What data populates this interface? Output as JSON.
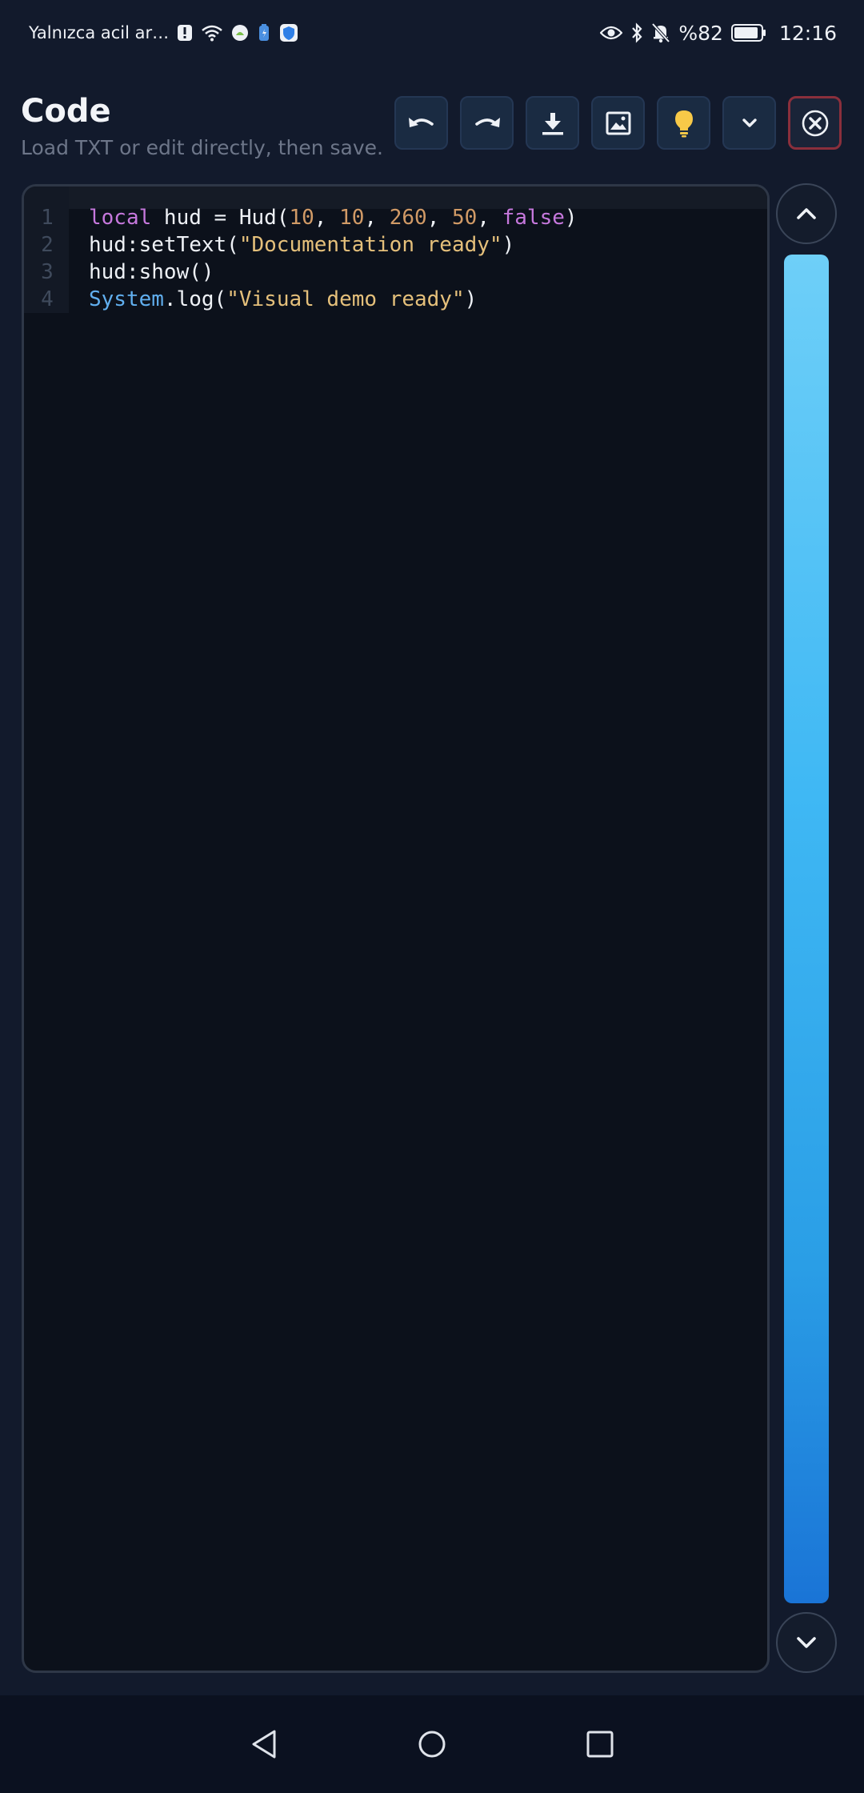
{
  "status_bar": {
    "carrier_text": "Yalnızca acil ar…",
    "battery_percent": "%82",
    "time": "12:16",
    "left_icons": [
      "alert-icon",
      "wifi-icon",
      "android-app-icon",
      "battery-saver-icon",
      "shield-app-icon"
    ],
    "right_icons": [
      "eye-icon",
      "bluetooth-icon",
      "bell-muted-icon",
      "battery-icon"
    ]
  },
  "header": {
    "title": "Code",
    "subtitle": "Load TXT or edit directly, then save."
  },
  "toolbar": {
    "buttons": [
      {
        "name": "undo",
        "icon": "undo-icon"
      },
      {
        "name": "redo",
        "icon": "redo-icon"
      },
      {
        "name": "download",
        "icon": "download-icon"
      },
      {
        "name": "image",
        "icon": "image-icon"
      },
      {
        "name": "hint",
        "icon": "lightbulb-icon"
      },
      {
        "name": "more",
        "icon": "chevron-down-icon"
      },
      {
        "name": "close",
        "icon": "close-icon"
      }
    ],
    "accent_close": "#8a2f3c",
    "accent_bulb": "#f7c948"
  },
  "editor": {
    "lines": [
      {
        "number": "1",
        "tokens": [
          {
            "t": "local",
            "c": "kw"
          },
          {
            "t": " hud = Hud(",
            "c": ""
          },
          {
            "t": "10",
            "c": "num"
          },
          {
            "t": ", ",
            "c": ""
          },
          {
            "t": "10",
            "c": "num"
          },
          {
            "t": ", ",
            "c": ""
          },
          {
            "t": "260",
            "c": "num"
          },
          {
            "t": ", ",
            "c": ""
          },
          {
            "t": "50",
            "c": "num"
          },
          {
            "t": ", ",
            "c": ""
          },
          {
            "t": "false",
            "c": "kw"
          },
          {
            "t": ")",
            "c": ""
          }
        ]
      },
      {
        "number": "2",
        "tokens": [
          {
            "t": "hud:setText(",
            "c": ""
          },
          {
            "t": "\"Documentation ready\"",
            "c": "str"
          },
          {
            "t": ")",
            "c": ""
          }
        ]
      },
      {
        "number": "3",
        "tokens": [
          {
            "t": "hud:show()",
            "c": ""
          }
        ]
      },
      {
        "number": "4",
        "tokens": [
          {
            "t": "System",
            "c": "sys"
          },
          {
            "t": ".log(",
            "c": ""
          },
          {
            "t": "\"Visual demo ready\"",
            "c": "str"
          },
          {
            "t": ")",
            "c": ""
          }
        ]
      }
    ]
  },
  "scroller": {
    "up_icon": "chevron-up-icon",
    "down_icon": "chevron-down-icon"
  },
  "nav_bar": {
    "buttons": [
      "back-icon",
      "home-icon",
      "recents-icon"
    ]
  }
}
